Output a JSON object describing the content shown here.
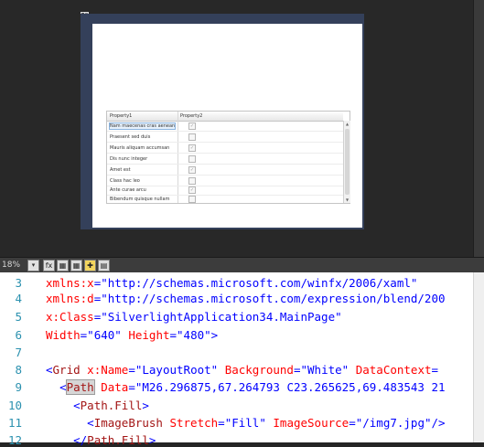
{
  "designer": {
    "grid": {
      "headers": [
        "Property1",
        "Property2"
      ],
      "rows": [
        {
          "text": "Nam maecenas cras aenean",
          "checked": "✓"
        },
        {
          "text": "Praesent sed duis",
          "checked": ""
        },
        {
          "text": "Mauris aliquam accumsan",
          "checked": "✓"
        },
        {
          "text": "Dis nunc integer",
          "checked": ""
        },
        {
          "text": "Amet est",
          "checked": "✓"
        },
        {
          "text": "Class hac leo",
          "checked": ""
        },
        {
          "text": "Ante curae arcu",
          "checked": "✓"
        },
        {
          "text": "Bibendum quisque nullam",
          "checked": ""
        }
      ]
    }
  },
  "toolbar": {
    "zoom": "18%"
  },
  "code": {
    "lines": [
      {
        "n": "3"
      },
      {
        "n": "4"
      },
      {
        "n": "5"
      },
      {
        "n": "6"
      },
      {
        "n": "7"
      },
      {
        "n": "8"
      },
      {
        "n": "9"
      },
      {
        "n": "10"
      },
      {
        "n": "11"
      },
      {
        "n": "12"
      }
    ],
    "l3": {
      "attr": "xmlns:x",
      "eq": "=",
      "val": "\"http://schemas.microsoft.com/winfx/2006/xaml\""
    },
    "l4": {
      "attr": "xmlns:d",
      "eq": "=",
      "val": "\"http://schemas.microsoft.com/expression/blend/200"
    },
    "l5": {
      "attr": "x:Class",
      "eq": "=",
      "val": "\"SilverlightApplication34.MainPage\""
    },
    "l6": {
      "a1": "Width",
      "v1": "\"640\"",
      "a2": "Height",
      "v2": "\"480\"",
      "end": ">"
    },
    "l8": {
      "lt": "<",
      "el": "Grid",
      "a1": "x:Name",
      "v1": "\"LayoutRoot\"",
      "a2": "Background",
      "v2": "\"White\"",
      "a3": "DataContext",
      "eq": "="
    },
    "l9": {
      "lt": "<",
      "el": "Path",
      "a1": "Data",
      "v1": "\"M26.296875,67.264793 C23.265625,69.483543 21"
    },
    "l10": {
      "lt": "<",
      "el": "Path.Fill",
      "gt": ">"
    },
    "l11": {
      "lt": "<",
      "el": "ImageBrush",
      "a1": "Stretch",
      "v1": "\"Fill\"",
      "a2": "ImageSource",
      "v2": "\"/img7.jpg\"",
      "end": "/>"
    },
    "l12": {
      "lt": "</",
      "el": "Path.Fill",
      "gt": ">"
    }
  }
}
